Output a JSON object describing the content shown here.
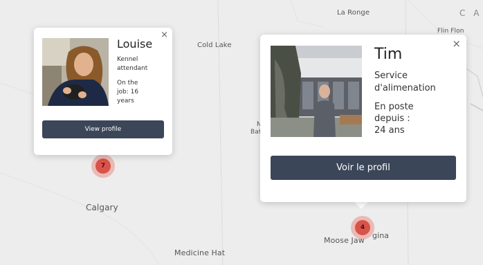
{
  "map": {
    "cities": [
      {
        "id": "la-ronge",
        "name": "La Ronge"
      },
      {
        "id": "flin-flon",
        "name": "Flin Flon"
      },
      {
        "id": "cold-lake",
        "name": "Cold Lake"
      },
      {
        "id": "calgary",
        "name": "Calgary"
      },
      {
        "id": "medicine-hat",
        "name": "Medicine Hat"
      },
      {
        "id": "moose-jaw",
        "name": "Moose Jaw"
      },
      {
        "id": "regina-partial",
        "name": "gina"
      },
      {
        "id": "partial-n",
        "name": "N"
      },
      {
        "id": "partial-bat",
        "name": "Bat"
      }
    ],
    "country_label": "C A",
    "clusters": [
      {
        "id": "cluster-7",
        "count": "7"
      },
      {
        "id": "cluster-4",
        "count": "4"
      }
    ],
    "colors": {
      "cluster": "#d9534a",
      "button": "#3b4658"
    }
  },
  "popups": {
    "louise": {
      "name": "Louise",
      "line1": "Kennel",
      "line2": "attendant",
      "line3": "On the",
      "line4": "job: 16",
      "line5": "years",
      "button": "View profile",
      "close": "×"
    },
    "tim": {
      "name": "Tim",
      "line1": "Service",
      "line2": "d'alimenation",
      "line3": "En poste",
      "line4": "depuis :",
      "line5": "24 ans",
      "button": "Voir le profil",
      "close": "×"
    }
  }
}
